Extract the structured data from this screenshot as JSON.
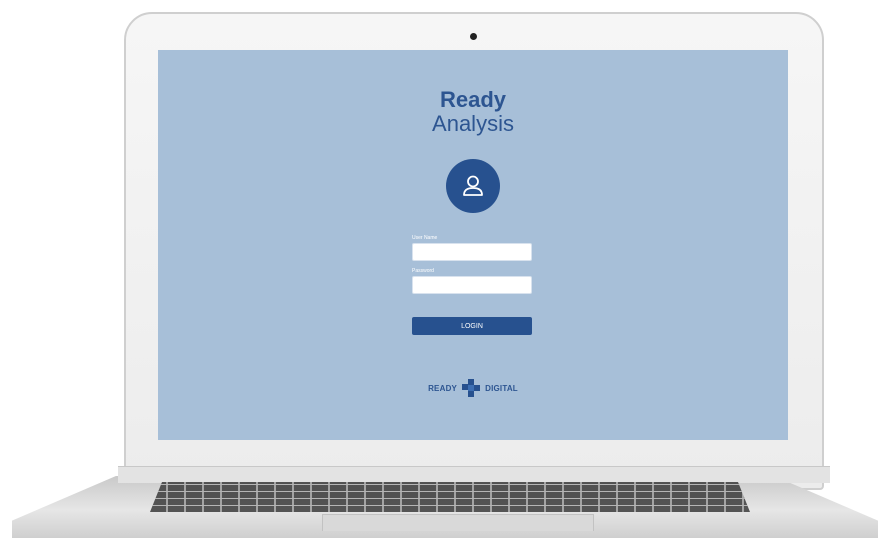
{
  "app": {
    "brand_line1": "Ready",
    "brand_line2": "Analysis"
  },
  "login": {
    "user_icon": "user-icon",
    "username_label": "User Name",
    "username_value": "",
    "password_label": "Password",
    "password_value": "",
    "login_button": "LOGIN"
  },
  "footer": {
    "logo_left": "Ready",
    "logo_right": "Digital",
    "logo_icon": "ready-digital-logo-icon"
  },
  "colors": {
    "screen_background": "#a7bfd8",
    "brand_blue": "#2d5591",
    "button_blue": "#27518f",
    "field_background": "#ffffff"
  }
}
